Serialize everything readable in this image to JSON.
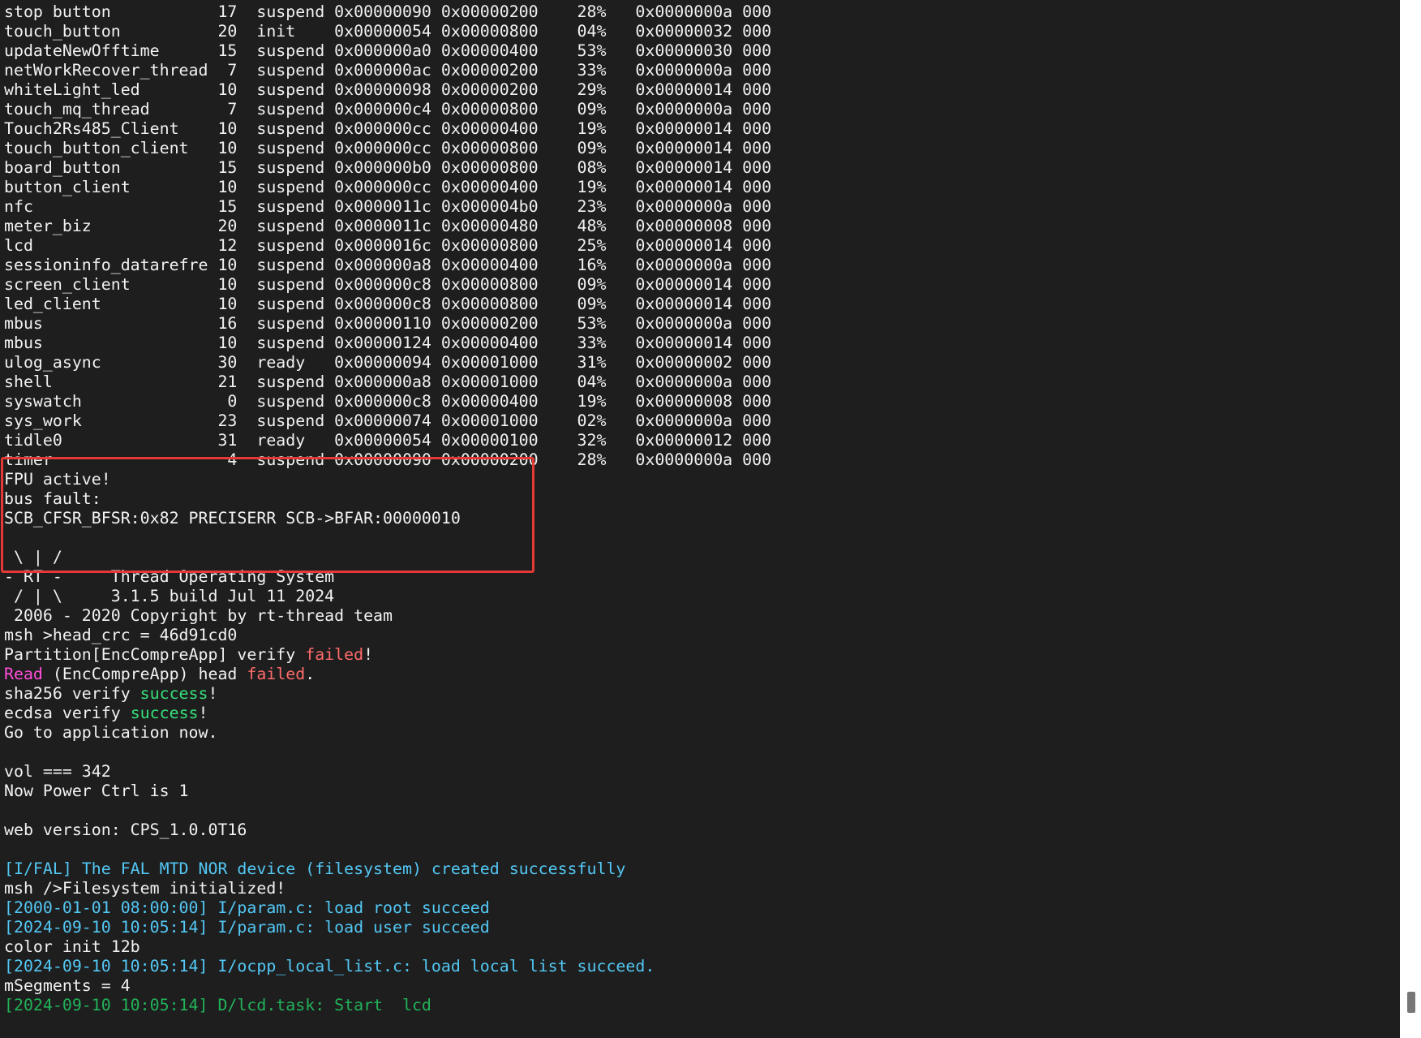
{
  "terminal": {
    "lines": [
      [
        {
          "t": "stop button           17  suspend 0x00000090 0x00000200    28%   0x0000000a 000",
          "c": "white"
        }
      ],
      [
        {
          "t": "touch_button          20  init    0x00000054 0x00000800    04%   0x00000032 000",
          "c": "white"
        }
      ],
      [
        {
          "t": "updateNewOfftime      15  suspend 0x000000a0 0x00000400    53%   0x00000030 000",
          "c": "white"
        }
      ],
      [
        {
          "t": "netWorkRecover_thread  7  suspend 0x000000ac 0x00000200    33%   0x0000000a 000",
          "c": "white"
        }
      ],
      [
        {
          "t": "whiteLight_led        10  suspend 0x00000098 0x00000200    29%   0x00000014 000",
          "c": "white"
        }
      ],
      [
        {
          "t": "touch_mq_thread        7  suspend 0x000000c4 0x00000800    09%   0x0000000a 000",
          "c": "white"
        }
      ],
      [
        {
          "t": "Touch2Rs485_Client    10  suspend 0x000000cc 0x00000400    19%   0x00000014 000",
          "c": "white"
        }
      ],
      [
        {
          "t": "touch_button_client   10  suspend 0x000000cc 0x00000800    09%   0x00000014 000",
          "c": "white"
        }
      ],
      [
        {
          "t": "board_button          15  suspend 0x000000b0 0x00000800    08%   0x00000014 000",
          "c": "white"
        }
      ],
      [
        {
          "t": "button_client         10  suspend 0x000000cc 0x00000400    19%   0x00000014 000",
          "c": "white"
        }
      ],
      [
        {
          "t": "nfc                   15  suspend 0x0000011c 0x000004b0    23%   0x0000000a 000",
          "c": "white"
        }
      ],
      [
        {
          "t": "meter_biz             20  suspend 0x0000011c 0x00000480    48%   0x00000008 000",
          "c": "white"
        }
      ],
      [
        {
          "t": "lcd                   12  suspend 0x0000016c 0x00000800    25%   0x00000014 000",
          "c": "white"
        }
      ],
      [
        {
          "t": "sessioninfo_datarefre 10  suspend 0x000000a8 0x00000400    16%   0x0000000a 000",
          "c": "white"
        }
      ],
      [
        {
          "t": "screen_client         10  suspend 0x000000c8 0x00000800    09%   0x00000014 000",
          "c": "white"
        }
      ],
      [
        {
          "t": "led_client            10  suspend 0x000000c8 0x00000800    09%   0x00000014 000",
          "c": "white"
        }
      ],
      [
        {
          "t": "mbus                  16  suspend 0x00000110 0x00000200    53%   0x0000000a 000",
          "c": "white"
        }
      ],
      [
        {
          "t": "mbus                  10  suspend 0x00000124 0x00000400    33%   0x00000014 000",
          "c": "white"
        }
      ],
      [
        {
          "t": "ulog_async            30  ready   0x00000094 0x00001000    31%   0x00000002 000",
          "c": "white"
        }
      ],
      [
        {
          "t": "shell                 21  suspend 0x000000a8 0x00001000    04%   0x0000000a 000",
          "c": "white"
        }
      ],
      [
        {
          "t": "syswatch               0  suspend 0x000000c8 0x00000400    19%   0x00000008 000",
          "c": "white"
        }
      ],
      [
        {
          "t": "sys_work              23  suspend 0x00000074 0x00001000    02%   0x0000000a 000",
          "c": "white"
        }
      ],
      [
        {
          "t": "tidle0                31  ready   0x00000054 0x00000100    32%   0x00000012 000",
          "c": "white"
        }
      ],
      [
        {
          "t": "timer                  4  suspend 0x00000090 0x00000200    28%   0x0000000a 000",
          "c": "white"
        }
      ],
      [
        {
          "t": "FPU active!",
          "c": "white"
        }
      ],
      [
        {
          "t": "bus fault:",
          "c": "white"
        }
      ],
      [
        {
          "t": "SCB_CFSR_BFSR:0x82 PRECISERR SCB->BFAR:00000010",
          "c": "white"
        }
      ],
      [
        {
          "t": "",
          "c": "white"
        }
      ],
      [
        {
          "t": " \\ | /",
          "c": "white"
        }
      ],
      [
        {
          "t": "- RT -     Thread Operating System",
          "c": "white"
        }
      ],
      [
        {
          "t": " / | \\     3.1.5 build Jul 11 2024",
          "c": "white"
        }
      ],
      [
        {
          "t": " 2006 - 2020 Copyright by rt-thread team",
          "c": "white"
        }
      ],
      [
        {
          "t": "msh >head_crc = 46d91cd0",
          "c": "white"
        }
      ],
      [
        {
          "t": "Partition[EncCompreApp] verify ",
          "c": "white"
        },
        {
          "t": "failed",
          "c": "red"
        },
        {
          "t": "!",
          "c": "white"
        }
      ],
      [
        {
          "t": "Read",
          "c": "magenta"
        },
        {
          "t": " (EncCompreApp) head ",
          "c": "white"
        },
        {
          "t": "failed",
          "c": "red"
        },
        {
          "t": ".",
          "c": "white"
        }
      ],
      [
        {
          "t": "sha256 verify ",
          "c": "white"
        },
        {
          "t": "success",
          "c": "green"
        },
        {
          "t": "!",
          "c": "white"
        }
      ],
      [
        {
          "t": "ecdsa verify ",
          "c": "white"
        },
        {
          "t": "success",
          "c": "green"
        },
        {
          "t": "!",
          "c": "white"
        }
      ],
      [
        {
          "t": "Go to application now.",
          "c": "white"
        }
      ],
      [
        {
          "t": "",
          "c": "white"
        }
      ],
      [
        {
          "t": "vol === 342",
          "c": "white"
        }
      ],
      [
        {
          "t": "Now Power Ctrl is 1",
          "c": "white"
        }
      ],
      [
        {
          "t": "",
          "c": "white"
        }
      ],
      [
        {
          "t": "web version: CPS_1.0.0T16",
          "c": "white"
        }
      ],
      [
        {
          "t": "",
          "c": "white"
        }
      ],
      [
        {
          "t": "[I/FAL] The FAL MTD NOR device (filesystem) created successfully",
          "c": "cyan"
        }
      ],
      [
        {
          "t": "msh />Filesystem initialized!",
          "c": "white"
        }
      ],
      [
        {
          "t": "[2000-01-01 08:00:00] I/param.c: load root succeed",
          "c": "cyan"
        }
      ],
      [
        {
          "t": "[2024-09-10 10:05:14] I/param.c: load user succeed",
          "c": "cyan"
        }
      ],
      [
        {
          "t": "color init 12b",
          "c": "white"
        }
      ],
      [
        {
          "t": "[2024-09-10 10:05:14] I/ocpp_local_list.c: load local list succeed.",
          "c": "cyan"
        }
      ],
      [
        {
          "t": "mSegments = 4",
          "c": "white"
        }
      ],
      [
        {
          "t": "[2024-09-10 10:05:14] D/lcd.task: Start  lcd",
          "c": "darkgreen"
        }
      ]
    ]
  }
}
